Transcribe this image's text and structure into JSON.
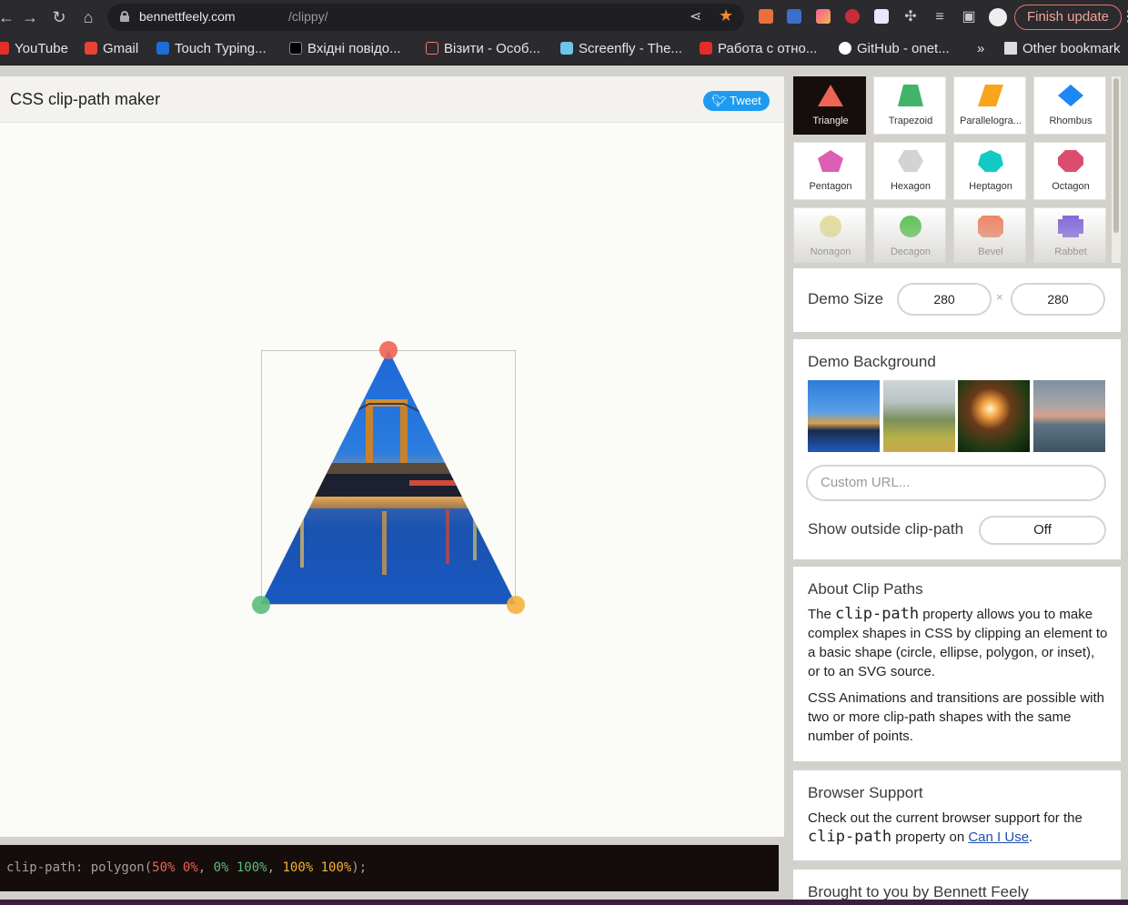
{
  "browser": {
    "url_host": "bennettfeely.com",
    "url_path": "/clippy/",
    "finish_update": "Finish update",
    "bookmarks": [
      "YouTube",
      "Gmail",
      "Touch Typing...",
      "Вхідні повідо...",
      "Візити - Особ...",
      "Screenfly - The...",
      "Работа с отно...",
      "GitHub - onet...",
      "Other bookmark"
    ],
    "overflow": "»"
  },
  "header": {
    "title": "CSS clip-path maker",
    "tweet": "Tweet"
  },
  "code": {
    "prop": "clip-path: ",
    "fn": "polygon(",
    "p1": "50% 0%",
    "p2": "0% 100%",
    "p3": "100% 100%",
    "sep": ", ",
    "end": ");"
  },
  "shapes": [
    {
      "label": "Triangle",
      "color": "#ef6452",
      "active": true
    },
    {
      "label": "Trapezoid",
      "color": "#43b36a"
    },
    {
      "label": "Parallelogra...",
      "color": "#f7a51b"
    },
    {
      "label": "Rhombus",
      "color": "#1c88f2"
    },
    {
      "label": "Pentagon",
      "color": "#dc5fb4"
    },
    {
      "label": "Hexagon",
      "color": "#d3d3d3"
    },
    {
      "label": "Heptagon",
      "color": "#14c9c4"
    },
    {
      "label": "Octagon",
      "color": "#dc4d6d"
    },
    {
      "label": "Nonagon",
      "color": "#e8e097"
    },
    {
      "label": "Decagon",
      "color": "#4fc34a"
    },
    {
      "label": "Bevel",
      "color": "#f27e5a"
    },
    {
      "label": "Rabbet",
      "color": "#7a5ce0"
    }
  ],
  "demo_size": {
    "label": "Demo Size",
    "width": "280",
    "height": "280",
    "times": "×"
  },
  "demo_background": {
    "title": "Demo Background",
    "custom_url_placeholder": "Custom URL...",
    "show_outside_label": "Show outside clip-path",
    "show_outside_value": "Off"
  },
  "about": {
    "title": "About Clip Paths",
    "p1_a": "The ",
    "p1_code": "clip-path",
    "p1_b": " property allows you to make complex shapes in CSS by clipping an element to a basic shape (circle, ellipse, polygon, or inset), or to an SVG source.",
    "p2": "CSS Animations and transitions are possible with two or more clip-path shapes with the same number of points."
  },
  "support": {
    "title": "Browser Support",
    "p_a": "Check out the current browser support for the ",
    "p_code": "clip-path",
    "p_b": " property on ",
    "link": "Can I Use",
    "p_end": "."
  },
  "credit": {
    "title": "Brought to you by Bennett Feely"
  },
  "handle_colors": {
    "top": "#ef6452",
    "left": "#5cbd7b",
    "right": "#f6b03d"
  }
}
